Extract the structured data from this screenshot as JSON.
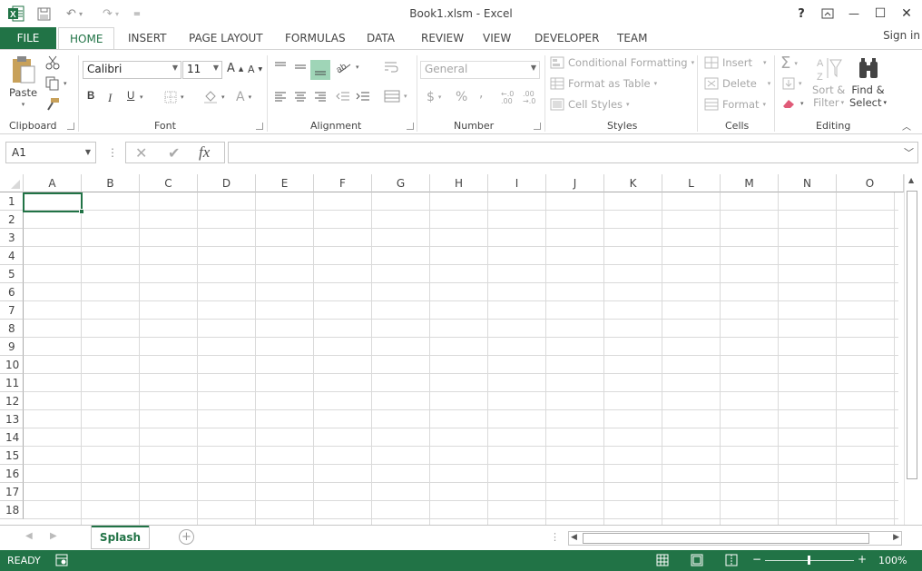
{
  "window": {
    "title": "Book1.xlsm - Excel",
    "help": "?",
    "minimize": "—",
    "maximize": "☐",
    "close": "✕"
  },
  "qat": {
    "customize": "="
  },
  "tabs": [
    {
      "label": "FILE"
    },
    {
      "label": "HOME"
    },
    {
      "label": "INSERT"
    },
    {
      "label": "PAGE LAYOUT"
    },
    {
      "label": "FORMULAS"
    },
    {
      "label": "DATA"
    },
    {
      "label": "REVIEW"
    },
    {
      "label": "VIEW"
    },
    {
      "label": "DEVELOPER"
    },
    {
      "label": "TEAM"
    }
  ],
  "signin": "Sign in",
  "ribbon": {
    "clipboard": {
      "label": "Clipboard",
      "paste": "Paste"
    },
    "font": {
      "label": "Font",
      "name": "Calibri",
      "size": "11",
      "bold": "B",
      "italic": "I",
      "underline": "U",
      "grow": "A",
      "shrink": "A",
      "color": "A"
    },
    "alignment": {
      "label": "Alignment"
    },
    "number": {
      "label": "Number",
      "format": "General",
      "currency": "$",
      "percent": "%",
      "comma": ",",
      "inc_decimal": "←.0 .00",
      "dec_decimal": ".00 →.0"
    },
    "styles": {
      "label": "Styles",
      "conditional": "Conditional Formatting",
      "format_table": "Format as Table",
      "cell_styles": "Cell Styles"
    },
    "cells": {
      "label": "Cells",
      "insert": "Insert",
      "delete": "Delete",
      "format": "Format"
    },
    "editing": {
      "label": "Editing",
      "sort_1": "Sort &",
      "sort_2": "Filter",
      "find_1": "Find &",
      "find_2": "Select"
    }
  },
  "formula_bar": {
    "name_box": "A1",
    "fx": "fx",
    "value": ""
  },
  "columns": [
    "A",
    "B",
    "C",
    "D",
    "E",
    "F",
    "G",
    "H",
    "I",
    "J",
    "K",
    "L",
    "M",
    "N",
    "O"
  ],
  "rows": [
    "1",
    "2",
    "3",
    "4",
    "5",
    "6",
    "7",
    "8",
    "9",
    "10",
    "11",
    "12",
    "13",
    "14",
    "15",
    "16",
    "17",
    "18"
  ],
  "sheets": [
    {
      "name": "Splash"
    }
  ],
  "status": {
    "mode": "READY",
    "zoom": "100%"
  },
  "colors": {
    "accent": "#217346"
  }
}
